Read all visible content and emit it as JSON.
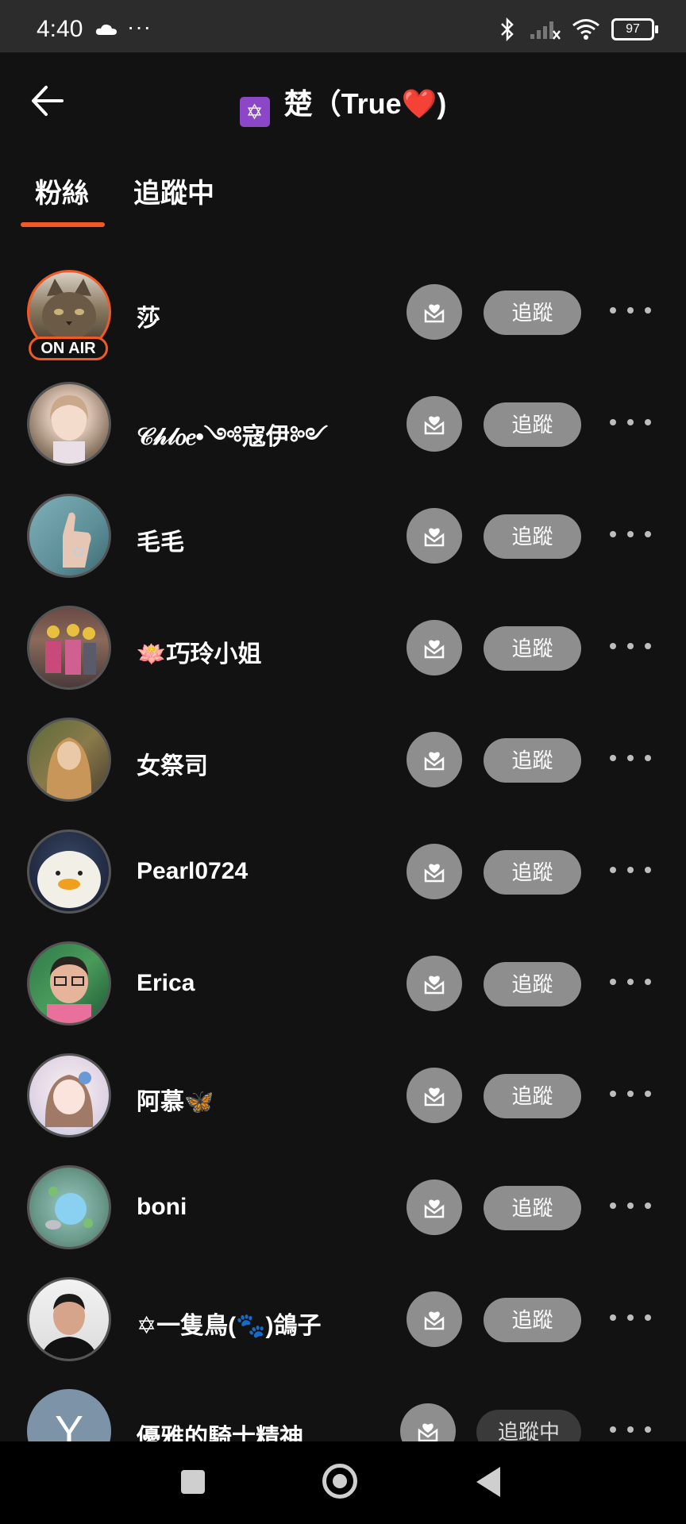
{
  "status_bar": {
    "time": "4:40",
    "dots": "···",
    "battery": "97"
  },
  "header": {
    "title": "楚（True❤️)",
    "badge": "✡"
  },
  "tabs": [
    {
      "label": "粉絲"
    },
    {
      "label": "追蹤中"
    }
  ],
  "onair_label": "ON AIR",
  "list": [
    {
      "name": "莎",
      "button": "追蹤"
    },
    {
      "name": "𝒞𝒽𝓁𝑜𝑒•༺寇伊༻",
      "button": "追蹤"
    },
    {
      "name": "毛毛",
      "button": "追蹤"
    },
    {
      "name": "🪷巧玲小姐",
      "button": "追蹤"
    },
    {
      "name": "女祭司",
      "button": "追蹤"
    },
    {
      "name": "Pearl0724",
      "button": "追蹤"
    },
    {
      "name": "Erica",
      "button": "追蹤"
    },
    {
      "name": "阿慕🦋",
      "button": "追蹤"
    },
    {
      "name": "boni",
      "button": "追蹤"
    },
    {
      "name": "✡一隻鳥(🐾)鴿子",
      "button": "追蹤"
    },
    {
      "name": "優雅的騎士精神",
      "button": "追蹤中",
      "avatar_letter": "Y"
    }
  ],
  "colors": {
    "accent": "#f05a24",
    "background": "#121212",
    "button_gray": "#8e8e8e"
  }
}
